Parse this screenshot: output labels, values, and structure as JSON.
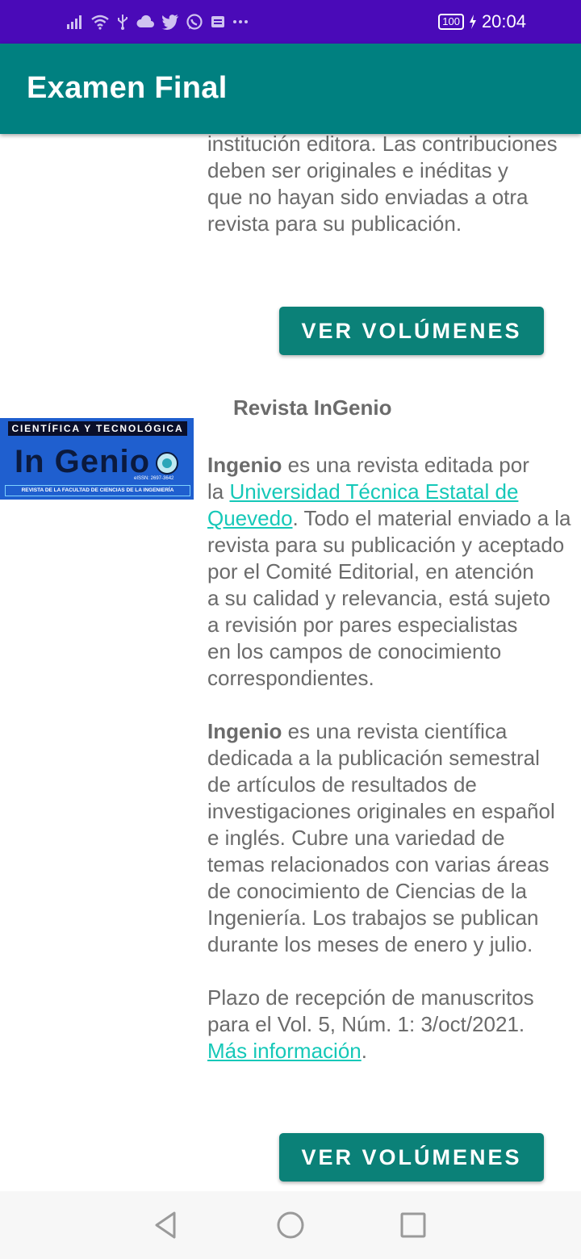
{
  "status_bar": {
    "battery": "100",
    "time": "20:04",
    "icons": [
      "signal-icon",
      "wifi-icon",
      "usb-icon",
      "cloud-icon",
      "twitter-icon",
      "whatsapp-icon",
      "message-icon",
      "more-icon"
    ]
  },
  "app_bar": {
    "title": "Examen Final"
  },
  "prev_card": {
    "lines": "institución editora. Las contribuciones\ndeben ser originales e inéditas y\nque no hayan sido enviadas a otra\nrevista para su publicación.",
    "button_label": "VER VOLÚMENES"
  },
  "card": {
    "title": "Revista InGenio",
    "logo": {
      "top_text": "CIENTÍFICA Y TECNOLÓGICA",
      "main_text": "In Genio",
      "issn": "eISSN: 2697-3642",
      "bottom_text": "REVISTA DE LA FACULTAD DE CIENCIAS DE LA INGENIERÍA"
    },
    "p1_bold": "Ingenio",
    "p1_a": " es una revista editada por\nla ",
    "p1_link": "Universidad Técnica Estatal de\nQuevedo",
    "p1_b": ". Todo el material enviado a la\nrevista para su publicación y aceptado\npor el Comité Editorial, en atención\na su calidad y relevancia, está sujeto\na revisión por pares especialistas\nen los campos de conocimiento\ncorrespondientes.",
    "p2_bold": "Ingenio",
    "p2_rest": " es una revista científica\ndedicada a la publicación semestral\nde artículos de resultados de\ninvestigaciones originales en español\ne inglés. Cubre una variedad de\ntemas relacionados con varias áreas\nde conocimiento de Ciencias de la\nIngeniería. Los trabajos se publican\ndurante los meses de enero y julio.",
    "p3_text": "Plazo de recepción de manuscritos\npara el Vol. 5, Núm. 1: 3/oct/2021.\n",
    "p3_link": "Más información",
    "p3_end": ".",
    "button_label": "VER VOLÚMENES"
  },
  "colors": {
    "status_bar": "#4a0ab8",
    "app_bar": "#008080",
    "button": "#0b8178",
    "link": "#15c8b8",
    "text": "#6b6b6b"
  }
}
